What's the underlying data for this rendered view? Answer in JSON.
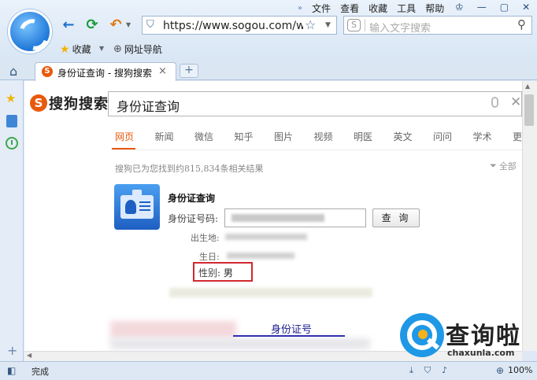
{
  "menu": {
    "items": [
      "文件",
      "查看",
      "收藏",
      "工具",
      "帮助"
    ]
  },
  "window_controls": {
    "skin": "♔",
    "minimize": "—",
    "restore": "▢",
    "close": "✕"
  },
  "toolbar": {
    "back": "←",
    "refresh": "⟳",
    "undo": "↶",
    "address": "https://www.sogou.com/we",
    "search_placeholder": "输入文字搜索",
    "favorites": "收藏",
    "site_nav": "网址导航"
  },
  "tab": {
    "title": "身份证查询 - 搜狗搜索",
    "close": "×",
    "new": "+"
  },
  "page": {
    "logo_s": "S",
    "logo_text": "搜狗搜索",
    "query": "身份证查询",
    "verticals": [
      "网页",
      "新闻",
      "微信",
      "知乎",
      "图片",
      "视频",
      "明医",
      "英文",
      "问问",
      "学术",
      "更"
    ],
    "result_count": "搜狗已为您找到约815,834条相关结果",
    "filter": "全部",
    "card": {
      "title": "身份证查询",
      "id_label": "身份证号码:",
      "query_button": "查 询",
      "birthplace_label": "出生地:",
      "birthday_label": "生日:",
      "gender_label": "性别:",
      "gender_value": "男"
    },
    "bottom_link": "身份证号"
  },
  "status": {
    "text": "完成",
    "zoom": "100%"
  },
  "watermark": {
    "title": "查询啦",
    "sub": "chaxunla.com"
  },
  "colors": {
    "accent": "#e8590c",
    "highlight_box": "#d0282e",
    "chrome": "#dfe9f5"
  }
}
